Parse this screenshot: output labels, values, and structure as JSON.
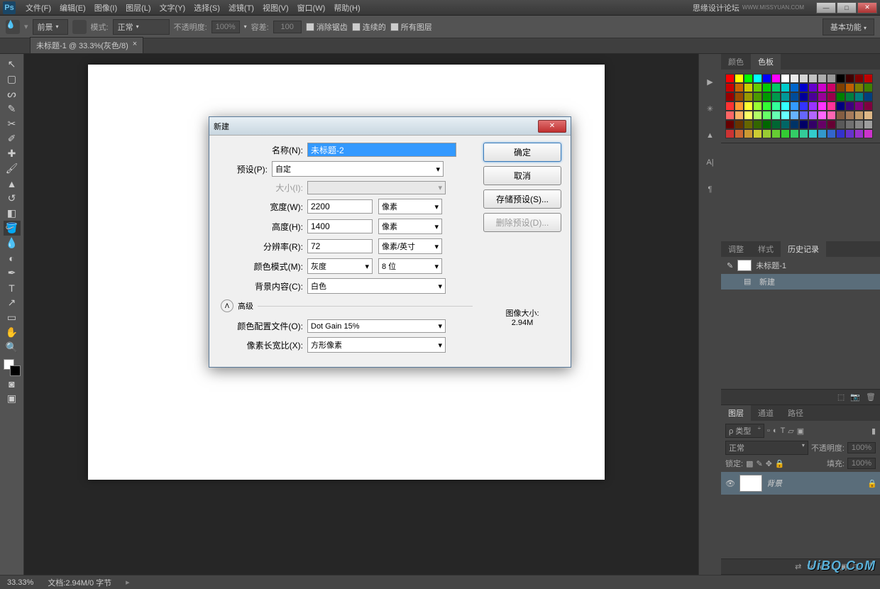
{
  "titlebar": {
    "logo": "Ps",
    "menus": [
      "文件(F)",
      "编辑(E)",
      "图像(I)",
      "图层(L)",
      "文字(Y)",
      "选择(S)",
      "滤镜(T)",
      "视图(V)",
      "窗口(W)",
      "帮助(H)"
    ],
    "forum": "思缘设计论坛",
    "forum_url": "WWW.MISSYUAN.COM"
  },
  "optionsbar": {
    "foreground": "前景",
    "mode_label": "模式:",
    "mode_value": "正常",
    "opacity_label": "不透明度:",
    "opacity_value": "100%",
    "tolerance_label": "容差:",
    "tolerance_value": "100",
    "antialias": "消除锯齿",
    "contiguous": "连续的",
    "all_layers": "所有图层",
    "preset": "基本功能"
  },
  "doctab": {
    "title": "未标题-1 @ 33.3%(灰色/8)",
    "close": "×"
  },
  "panels": {
    "color_tab": "颜色",
    "swatches_tab": "色板",
    "adjust_tab": "调整",
    "styles_tab": "样式",
    "history_tab": "历史记录",
    "history_doc": "未标题-1",
    "history_item": "新建",
    "layers_tab": "图层",
    "channels_tab": "通道",
    "paths_tab": "路径",
    "kind_label": "ρ 类型",
    "blend_mode": "正常",
    "opacity_label": "不透明度:",
    "opacity_value": "100%",
    "lock_label": "锁定:",
    "fill_label": "填充:",
    "fill_value": "100%",
    "bg_layer": "背景"
  },
  "swatch_colors": [
    "#ff0000",
    "#ffff00",
    "#00ff00",
    "#00ffff",
    "#0000ff",
    "#ff00ff",
    "#ffffff",
    "#ebebeb",
    "#d6d6d6",
    "#c2c2c2",
    "#adadad",
    "#999999",
    "#000000",
    "#3f0000",
    "#7f0000",
    "#bf0000",
    "#cc0000",
    "#cc6600",
    "#cccc00",
    "#66cc00",
    "#00cc00",
    "#00cc66",
    "#00cccc",
    "#0066cc",
    "#0000cc",
    "#6600cc",
    "#cc00cc",
    "#cc0066",
    "#7f3f00",
    "#bf5f00",
    "#7f7f00",
    "#3f7f00",
    "#990000",
    "#994c00",
    "#999900",
    "#4c9900",
    "#009900",
    "#00994c",
    "#009999",
    "#004c99",
    "#000099",
    "#4c0099",
    "#990099",
    "#99004c",
    "#007f00",
    "#007f3f",
    "#007f7f",
    "#003f7f",
    "#ff3333",
    "#ff9933",
    "#ffff33",
    "#99ff33",
    "#33ff33",
    "#33ff99",
    "#33ffff",
    "#3399ff",
    "#3333ff",
    "#9933ff",
    "#ff33ff",
    "#ff3399",
    "#00007f",
    "#3f007f",
    "#7f007f",
    "#7f003f",
    "#ff6666",
    "#ffb266",
    "#ffff66",
    "#b2ff66",
    "#66ff66",
    "#66ffb2",
    "#66ffff",
    "#66b2ff",
    "#6666ff",
    "#b266ff",
    "#ff66ff",
    "#ff66b2",
    "#855e42",
    "#a67b5b",
    "#c19a6b",
    "#deb887",
    "#660000",
    "#663300",
    "#666600",
    "#336600",
    "#006600",
    "#006633",
    "#006666",
    "#003366",
    "#000066",
    "#330066",
    "#660066",
    "#660033",
    "#595959",
    "#707070",
    "#878787",
    "#9e9e9e",
    "#cc3333",
    "#cc6633",
    "#cc9933",
    "#cccc33",
    "#99cc33",
    "#66cc33",
    "#33cc33",
    "#33cc66",
    "#33cc99",
    "#33cccc",
    "#3399cc",
    "#3366cc",
    "#3333cc",
    "#6633cc",
    "#9933cc",
    "#cc33cc"
  ],
  "statusbar": {
    "zoom": "33.33%",
    "doc_info": "文档:2.94M/0 字节"
  },
  "dialog": {
    "title": "新建",
    "name_label": "名称(N):",
    "name_value": "未标题-2",
    "preset_label": "预设(P):",
    "preset_value": "自定",
    "size_label": "大小(I):",
    "width_label": "宽度(W):",
    "width_value": "2200",
    "width_unit": "像素",
    "height_label": "高度(H):",
    "height_value": "1400",
    "height_unit": "像素",
    "res_label": "分辨率(R):",
    "res_value": "72",
    "res_unit": "像素/英寸",
    "mode_label": "颜色模式(M):",
    "mode_value": "灰度",
    "mode_bits": "8 位",
    "bg_label": "背景内容(C):",
    "bg_value": "白色",
    "advanced": "高级",
    "profile_label": "颜色配置文件(O):",
    "profile_value": "Dot Gain 15%",
    "aspect_label": "像素长宽比(X):",
    "aspect_value": "方形像素",
    "ok": "确定",
    "cancel": "取消",
    "save_preset": "存储预设(S)...",
    "del_preset": "删除预设(D)...",
    "img_size_label": "图像大小:",
    "img_size_value": "2.94M"
  },
  "watermark": "UiBQ.CoM"
}
